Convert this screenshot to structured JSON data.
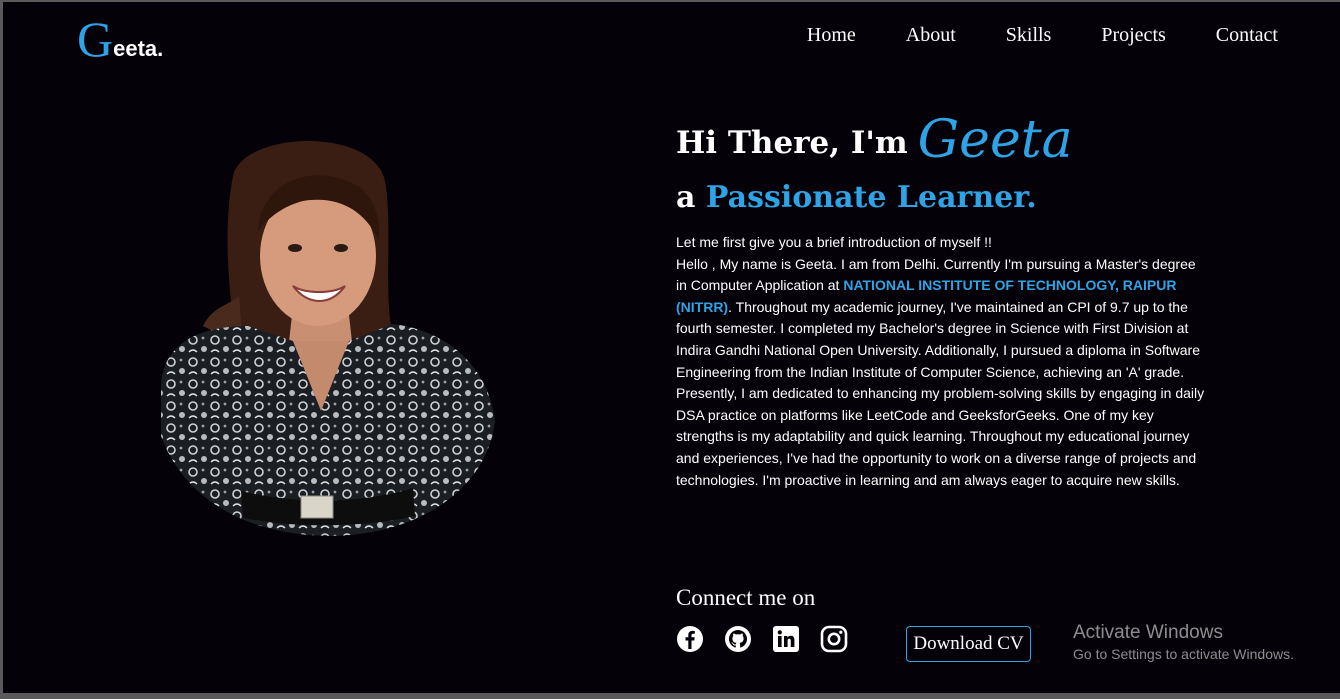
{
  "brand": {
    "first_letter": "G",
    "rest": "eeta."
  },
  "nav": {
    "items": [
      {
        "label": "Home"
      },
      {
        "label": "About"
      },
      {
        "label": "Skills"
      },
      {
        "label": "Projects"
      },
      {
        "label": "Contact"
      }
    ]
  },
  "hero": {
    "greeting": "Hi There, I'm",
    "name": "Geeta",
    "tagline_prefix": "a",
    "tagline_accent": "Passionate Learner.",
    "intro_lead": "Let me first give you a brief introduction of myself !!",
    "bio_part1": "Hello , My name is Geeta. I am from Delhi. Currently I'm pursuing a Master's degree in Computer Application at",
    "bio_highlight": "NATIONAL INSTITUTE OF TECHNOLOGY, RAIPUR (NITRR)",
    "bio_part2": ". Throughout my academic journey, I've maintained an CPI of 9.7 up to the fourth semester. I completed my Bachelor's degree in Science with First Division at Indira Gandhi National Open University. Additionally, I pursued a diploma in Software Engineering from the Indian Institute of Computer Science, achieving an 'A' grade. Presently, I am dedicated to enhancing my problem-solving skills by engaging in daily DSA practice on platforms like LeetCode and GeeksforGeeks. One of my key strengths is my adaptability and quick learning. Throughout my educational journey and experiences, I've had the opportunity to work on a diverse range of projects and technologies. I'm proactive in learning and am always eager to acquire new skills."
  },
  "connect": {
    "heading": "Connect me on",
    "icons": [
      "facebook-icon",
      "github-icon",
      "linkedin-icon",
      "instagram-icon"
    ],
    "cv_button": "Download CV"
  },
  "watermark": {
    "title": "Activate Windows",
    "subtitle": "Go to Settings to activate Windows."
  },
  "colors": {
    "background": "#040108",
    "accent": "#2ea4e6",
    "text": "#ffffff"
  }
}
